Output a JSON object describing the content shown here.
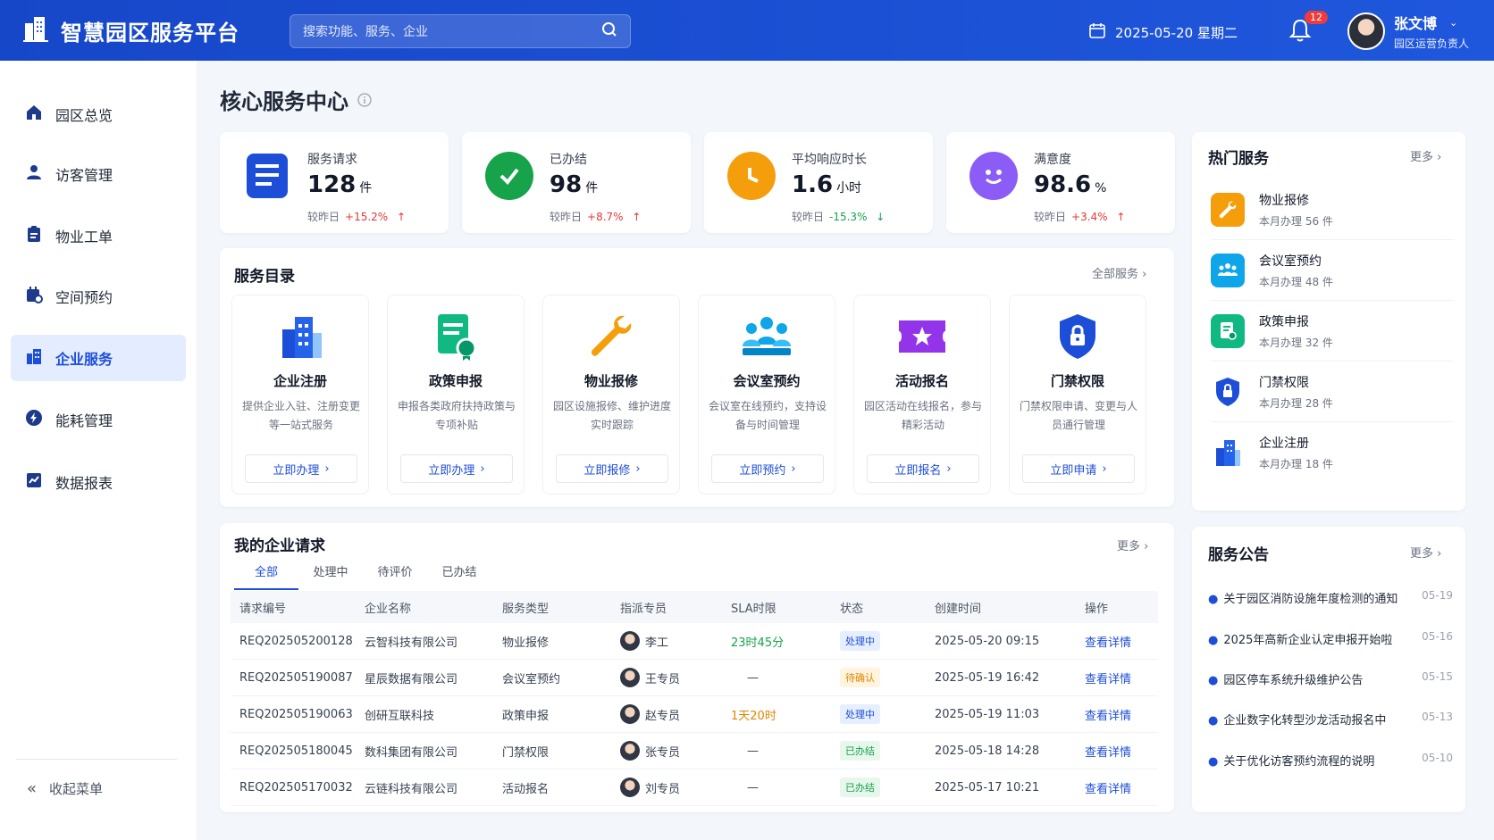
{
  "app": {
    "title": "智慧园区服务平台"
  },
  "search": {
    "placeholder": "搜索功能、服务、企业"
  },
  "header": {
    "date": "2025-05-20 星期二",
    "notif_count": "12"
  },
  "user": {
    "name": "张文博",
    "role": "园区运营负责人"
  },
  "sidebar": {
    "items": [
      {
        "label": "园区总览",
        "icon": "home-icon"
      },
      {
        "label": "访客管理",
        "icon": "user-icon"
      },
      {
        "label": "物业工单",
        "icon": "clipboard-icon"
      },
      {
        "label": "空间预约",
        "icon": "calendar-icon"
      },
      {
        "label": "企业服务",
        "icon": "building-icon",
        "active": true
      },
      {
        "label": "能耗管理",
        "icon": "bolt-icon"
      },
      {
        "label": "数据报表",
        "icon": "chart-icon"
      }
    ],
    "collapse": "收起菜单"
  },
  "page": {
    "title": "核心服务中心"
  },
  "stats": [
    {
      "label": "服务请求",
      "value": "128",
      "unit": "件",
      "cmp": "较昨日",
      "delta": "+15.2%",
      "dir": "↑",
      "color": "#1d4ed8"
    },
    {
      "label": "已办结",
      "value": "98",
      "unit": "件",
      "cmp": "较昨日",
      "delta": "+8.7%",
      "dir": "↑",
      "color": "#16a34a"
    },
    {
      "label": "平均响应时长",
      "value": "1.6",
      "unit": "小时",
      "cmp": "较昨日",
      "delta": "-15.3%",
      "dir": "↓",
      "color": "#f59e0b"
    },
    {
      "label": "满意度",
      "value": "98.6",
      "unit": "%",
      "cmp": "较昨日",
      "delta": "+3.4%",
      "dir": "↑",
      "color": "#8b5cf6"
    }
  ],
  "catalog": {
    "title": "服务目录",
    "more": "全部服务",
    "items": [
      {
        "name": "企业注册",
        "desc": "提供企业入驻、注册变更等一站式服务",
        "btn": "立即办理"
      },
      {
        "name": "政策申报",
        "desc": "申报各类政府扶持政策与专项补贴",
        "btn": "立即办理"
      },
      {
        "name": "物业报修",
        "desc": "园区设施报修、维护进度实时跟踪",
        "btn": "立即报修"
      },
      {
        "name": "会议室预约",
        "desc": "会议室在线预约，支持设备与时间管理",
        "btn": "立即预约"
      },
      {
        "name": "活动报名",
        "desc": "园区活动在线报名，参与精彩活动",
        "btn": "立即报名"
      },
      {
        "name": "门禁权限",
        "desc": "门禁权限申请、变更与人员通行管理",
        "btn": "立即申请"
      }
    ]
  },
  "requests": {
    "title": "我的企业请求",
    "more": "更多",
    "tabs": [
      "全部",
      "处理中",
      "待评价",
      "已办结"
    ],
    "columns": [
      "请求编号",
      "企业名称",
      "服务类型",
      "指派专员",
      "SLA时限",
      "状态",
      "创建时间",
      "操作"
    ],
    "rows": [
      {
        "id": "REQ202505200128",
        "company": "云智科技有限公司",
        "type": "物业报修",
        "agent": "李工",
        "sla": "23时45分",
        "status": "处理中",
        "time": "2025-05-20  09:15",
        "action": "查看详情"
      },
      {
        "id": "REQ202505190087",
        "company": "星辰数据有限公司",
        "type": "会议室预约",
        "agent": "王专员",
        "sla": "—",
        "status": "待确认",
        "time": "2025-05-19  16:42",
        "action": "查看详情"
      },
      {
        "id": "REQ202505190063",
        "company": "创研互联科技",
        "type": "政策申报",
        "agent": "赵专员",
        "sla": "1天20时",
        "status": "处理中",
        "time": "2025-05-19  11:03",
        "action": "查看详情"
      },
      {
        "id": "REQ202505180045",
        "company": "数科集团有限公司",
        "type": "门禁权限",
        "agent": "张专员",
        "sla": "—",
        "status": "已办结",
        "time": "2025-05-18  14:28",
        "action": "查看详情"
      },
      {
        "id": "REQ202505170032",
        "company": "云链科技有限公司",
        "type": "活动报名",
        "agent": "刘专员",
        "sla": "—",
        "status": "已办结",
        "time": "2025-05-17  10:21",
        "action": "查看详情"
      }
    ]
  },
  "hot": {
    "title": "热门服务",
    "more": "更多",
    "items": [
      {
        "name": "物业报修",
        "count": "本月办理  56 件"
      },
      {
        "name": "会议室预约",
        "count": "本月办理  48 件"
      },
      {
        "name": "政策申报",
        "count": "本月办理  32 件"
      },
      {
        "name": "门禁权限",
        "count": "本月办理  28 件"
      },
      {
        "name": "企业注册",
        "count": "本月办理  18 件"
      }
    ]
  },
  "notices": {
    "title": "服务公告",
    "more": "更多",
    "items": [
      {
        "text": "关于园区消防设施年度检测的通知",
        "date": "05-19"
      },
      {
        "text": "2025年高新企业认定申报开始啦",
        "date": "05-16"
      },
      {
        "text": "园区停车系统升级维护公告",
        "date": "05-15"
      },
      {
        "text": "企业数字化转型沙龙活动报名中",
        "date": "05-13"
      },
      {
        "text": "关于优化访客预约流程的说明",
        "date": "05-10"
      }
    ]
  }
}
